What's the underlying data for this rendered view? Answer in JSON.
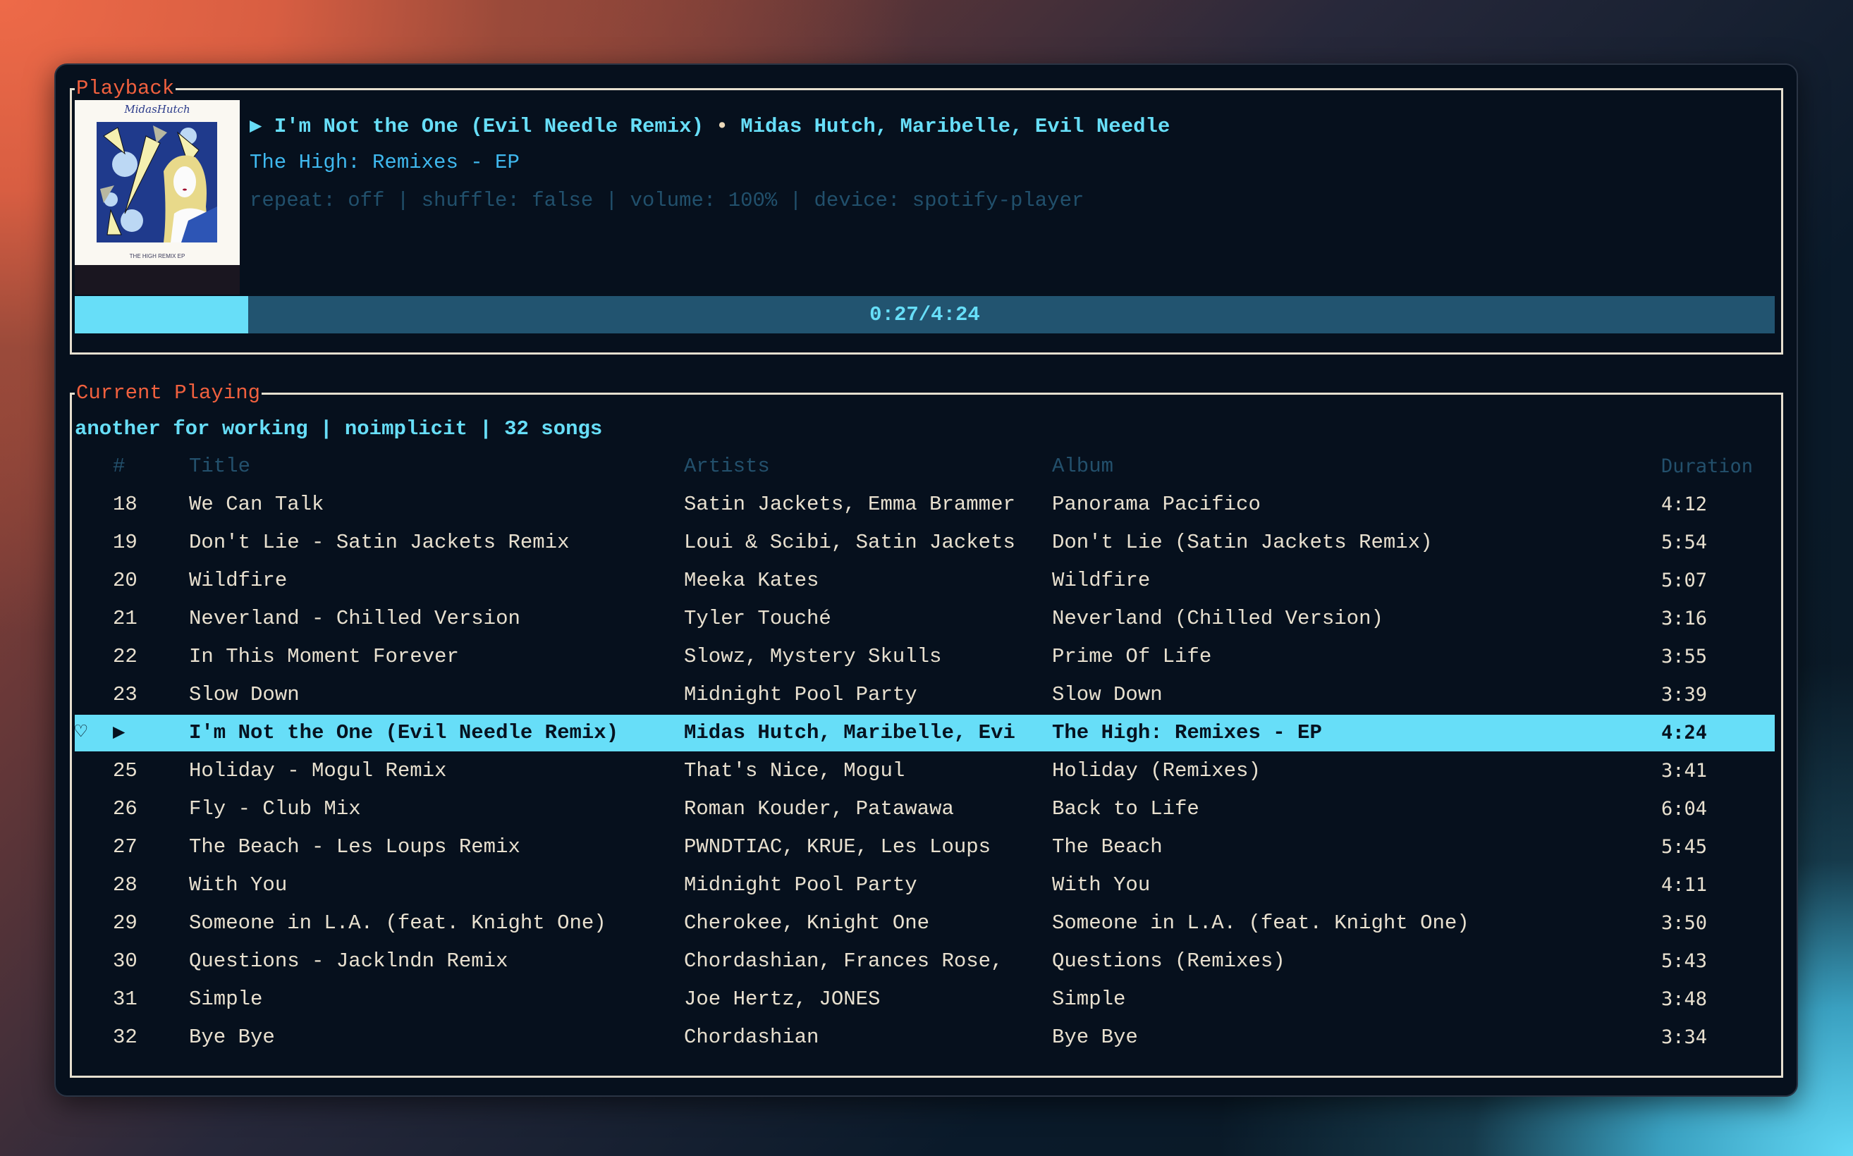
{
  "playback": {
    "panel_title": "Playback",
    "play_state_icon": "▶",
    "track_title": "I'm Not the One (Evil Needle Remix)",
    "separator": "•",
    "track_artists": "Midas Hutch, Maribelle, Evil Needle",
    "album": "The High: Remixes - EP",
    "status": "repeat: off | shuffle: false | volume: 100% | device: spotify-player",
    "album_art": {
      "artist_script": "MidasHutch",
      "caption": "THE HIGH REMIX EP"
    },
    "progress": {
      "elapsed": "0:27",
      "total": "4:24",
      "label": "0:27/4:24",
      "fraction": 0.102
    }
  },
  "current_playing": {
    "panel_title": "Current Playing",
    "playlist_info": "another for working | noimplicit | 32 songs",
    "columns": {
      "num": "#",
      "title": "Title",
      "artists": "Artists",
      "album": "Album",
      "duration": "Duration"
    },
    "rows": [
      {
        "mark": "",
        "num": "18",
        "title": "We Can Talk",
        "artists": "Satin Jackets, Emma Brammer",
        "album": "Panorama Pacifico",
        "duration": "4:12"
      },
      {
        "mark": "",
        "num": "19",
        "title": "Don't Lie - Satin Jackets Remix",
        "artists": "Loui & Scibi, Satin Jackets",
        "album": "Don't Lie (Satin Jackets Remix)",
        "duration": "5:54"
      },
      {
        "mark": "",
        "num": "20",
        "title": "Wildfire",
        "artists": "Meeka Kates",
        "album": "Wildfire",
        "duration": "5:07"
      },
      {
        "mark": "",
        "num": "21",
        "title": "Neverland - Chilled Version",
        "artists": "Tyler Touché",
        "album": "Neverland (Chilled Version)",
        "duration": "3:16"
      },
      {
        "mark": "",
        "num": "22",
        "title": "In This Moment Forever",
        "artists": "Slowz, Mystery Skulls",
        "album": "Prime Of Life",
        "duration": "3:55"
      },
      {
        "mark": "",
        "num": "23",
        "title": "Slow Down",
        "artists": "Midnight Pool Party",
        "album": "Slow Down",
        "duration": "3:39"
      },
      {
        "mark": "♡",
        "num": "▶",
        "title": "I'm Not the One (Evil Needle Remix)",
        "artists": "Midas Hutch, Maribelle, Evi",
        "album": "The High: Remixes - EP",
        "duration": "4:24",
        "active": true
      },
      {
        "mark": "",
        "num": "25",
        "title": "Holiday - Mogul Remix",
        "artists": "That's Nice, Mogul",
        "album": "Holiday (Remixes)",
        "duration": "3:41"
      },
      {
        "mark": "",
        "num": "26",
        "title": "Fly - Club Mix",
        "artists": "Roman Kouder, Patawawa",
        "album": "Back to Life",
        "duration": "6:04"
      },
      {
        "mark": "",
        "num": "27",
        "title": "The Beach - Les Loups Remix",
        "artists": "PWNDTIAC, KRUE, Les Loups",
        "album": "The Beach",
        "duration": "5:45"
      },
      {
        "mark": "",
        "num": "28",
        "title": "With You",
        "artists": "Midnight Pool Party",
        "album": "With You",
        "duration": "4:11"
      },
      {
        "mark": "",
        "num": "29",
        "title": "Someone in L.A. (feat. Knight One)",
        "artists": "Cherokee, Knight One",
        "album": "Someone in L.A. (feat. Knight One)",
        "duration": "3:50"
      },
      {
        "mark": "",
        "num": "30",
        "title": "Questions - Jacklndn Remix",
        "artists": "Chordashian, Frances Rose,",
        "album": "Questions (Remixes)",
        "duration": "5:43"
      },
      {
        "mark": "",
        "num": "31",
        "title": "Simple",
        "artists": "Joe Hertz, JONES",
        "album": "Simple",
        "duration": "3:48"
      },
      {
        "mark": "",
        "num": "32",
        "title": "Bye Bye",
        "artists": "Chordashian",
        "album": "Bye Bye",
        "duration": "3:34"
      }
    ]
  },
  "colors": {
    "accent": "#67def8",
    "panel_title": "#f0603e",
    "text": "#e8e0cf",
    "muted": "#23506c",
    "album_text": "#3fb8ee",
    "progress_track": "#225470",
    "background": "#06101d"
  }
}
